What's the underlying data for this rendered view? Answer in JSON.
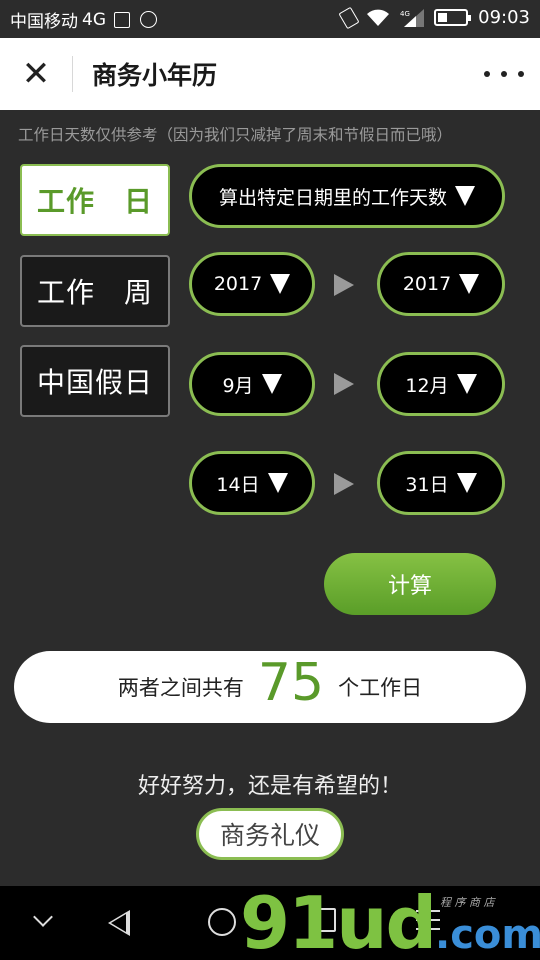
{
  "status_bar": {
    "carrier": "中国移动",
    "network": "4G",
    "data_tag": "4G",
    "time": "09:03"
  },
  "title_bar": {
    "close_glyph": "✕",
    "title": "商务小年历"
  },
  "note": "工作日天数仅供参考（因为我们只减掉了周末和节假日而已哦）",
  "modes": [
    {
      "label": "工作　日",
      "active": true
    },
    {
      "label": "工作　周",
      "active": false
    },
    {
      "label": "中国假日",
      "active": false
    }
  ],
  "calc_type": {
    "label": "算出特定日期里的工作天数"
  },
  "range": {
    "start_year": "2017",
    "end_year": "2017",
    "start_month": "9月",
    "end_month": "12月",
    "start_day": "14日",
    "end_day": "31日"
  },
  "calc_button": "计算",
  "result": {
    "prefix": "两者之间共有",
    "count": "75",
    "suffix": "个工作日"
  },
  "encourage": "好好努力，还是有希望的！",
  "etiquette_button": "商务礼仪",
  "watermark": {
    "main": "91ud",
    "tld": ".com",
    "small": "程 序 商 店"
  },
  "colors": {
    "accent_green": "#8bbd52",
    "result_green": "#5a9a2a",
    "background": "#2c2c2c"
  }
}
